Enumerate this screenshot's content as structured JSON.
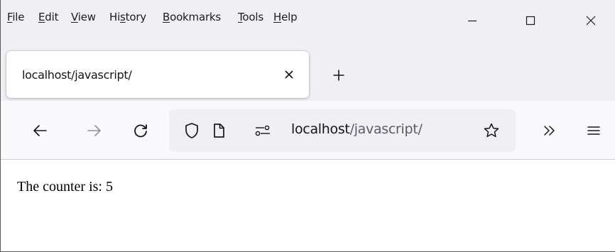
{
  "menubar": {
    "items": [
      {
        "label": "File",
        "accel": "F",
        "rest": "ile"
      },
      {
        "label": "Edit",
        "accel": "E",
        "rest": "dit"
      },
      {
        "label": "View",
        "accel": "V",
        "rest": "iew"
      },
      {
        "label": "History",
        "pre": "Hi",
        "accel": "s",
        "rest": "tory"
      },
      {
        "label": "Bookmarks",
        "accel": "B",
        "rest": "ookmarks"
      },
      {
        "label": "Tools",
        "accel": "T",
        "rest": "ools"
      },
      {
        "label": "Help",
        "accel": "H",
        "rest": "elp"
      }
    ]
  },
  "window_controls": {
    "minimize_icon": "minimize-icon",
    "maximize_icon": "maximize-icon",
    "close_icon": "close-icon"
  },
  "tab": {
    "title": "localhost/javascript/",
    "close_icon": "close-icon"
  },
  "new_tab_icon": "plus-icon",
  "navbar": {
    "back_icon": "arrow-left-icon",
    "forward_icon": "arrow-right-icon",
    "reload_icon": "reload-icon",
    "url": {
      "host": "localhost",
      "path": "/javascript/",
      "shield_icon": "shield-icon",
      "page_icon": "page-icon",
      "permissions_icon": "site-permissions-icon",
      "bookmark_icon": "star-icon"
    },
    "overflow_icon": "chevron-double-right-icon",
    "menu_icon": "hamburger-menu-icon"
  },
  "page": {
    "text": "The counter is: 5"
  },
  "colors": {
    "chrome_bg": "#f0f0f4",
    "navbar_bg": "#f9f9fb",
    "urlbar_bg": "#f0f0f4",
    "url_path": "#5b5b66",
    "text": "#15141a"
  }
}
